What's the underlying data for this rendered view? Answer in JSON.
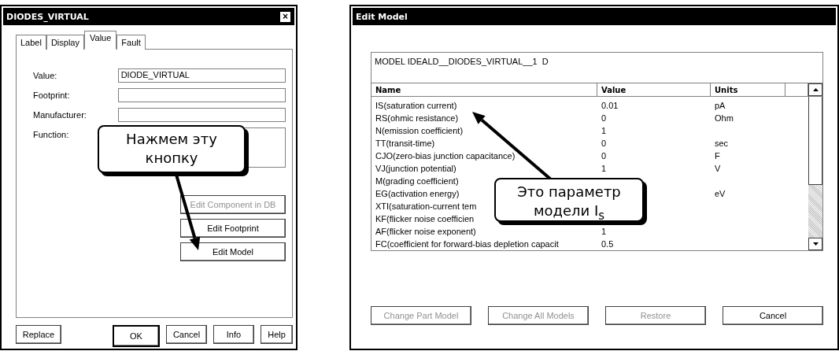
{
  "component_dialog": {
    "title": "DIODES_VIRTUAL",
    "close": "×",
    "tabs": [
      {
        "label": "Label",
        "selected": false
      },
      {
        "label": "Display",
        "selected": false
      },
      {
        "label": "Value",
        "selected": true
      },
      {
        "label": "Fault",
        "selected": false
      }
    ],
    "fields": [
      {
        "label": "Value:",
        "value": "DIODE_VIRTUAL",
        "kind": "line"
      },
      {
        "label": "Footprint:",
        "kind": "line"
      },
      {
        "label": "Manufacturer:",
        "kind": "line"
      },
      {
        "label": "Function:",
        "kind": "area"
      }
    ],
    "side_buttons": [
      {
        "label": "Edit Component in DB",
        "disabled": true
      },
      {
        "label": "Edit Footprint",
        "disabled": false
      },
      {
        "label": "Edit Model",
        "disabled": false
      }
    ],
    "footer_buttons": [
      {
        "label": "Replace",
        "default": false
      },
      {
        "label": "OK",
        "default": true
      },
      {
        "label": "Cancel",
        "default": false
      },
      {
        "label": "Info",
        "default": false
      },
      {
        "label": "Help",
        "default": false
      }
    ]
  },
  "model_dialog": {
    "title": "Edit Model",
    "model_line": "MODEL IDEALD__DIODES_VIRTUAL__1  D",
    "columns": [
      "Name",
      "Value",
      "Units"
    ],
    "rows": [
      {
        "name": "IS(saturation current)",
        "value": "0.01",
        "units": "pA"
      },
      {
        "name": "RS(ohmic resistance)",
        "value": "0",
        "units": "Ohm"
      },
      {
        "name": "N(emission coefficient)",
        "value": "1"
      },
      {
        "name": "TT(transit-time)",
        "value": "0",
        "units": "sec"
      },
      {
        "name": "CJO(zero-bias junction capacitance)",
        "value": "0",
        "units": "F"
      },
      {
        "name": "VJ(junction potential)",
        "value": "1",
        "units": "V"
      },
      {
        "name": "M(grading coefficient)"
      },
      {
        "name": "EG(activation energy)",
        "units": "eV"
      },
      {
        "name": "XTI(saturation-current tem"
      },
      {
        "name": "KF(flicker noise coefficien"
      },
      {
        "name": "AF(flicker noise exponent)",
        "value": "1"
      },
      {
        "name": "FC(coefficient for forward-bias depletion capacit",
        "value": "0.5"
      }
    ],
    "buttons": [
      {
        "label": "Change Part Model",
        "disabled": true
      },
      {
        "label": "Change All Models",
        "disabled": true
      },
      {
        "label": "Restore",
        "disabled": true
      },
      {
        "label": "Cancel",
        "disabled": false
      }
    ]
  },
  "callouts": [
    {
      "text": "Нажмем эту кнопку"
    },
    {
      "text": "Это параметр модели I$_{s}$"
    }
  ]
}
